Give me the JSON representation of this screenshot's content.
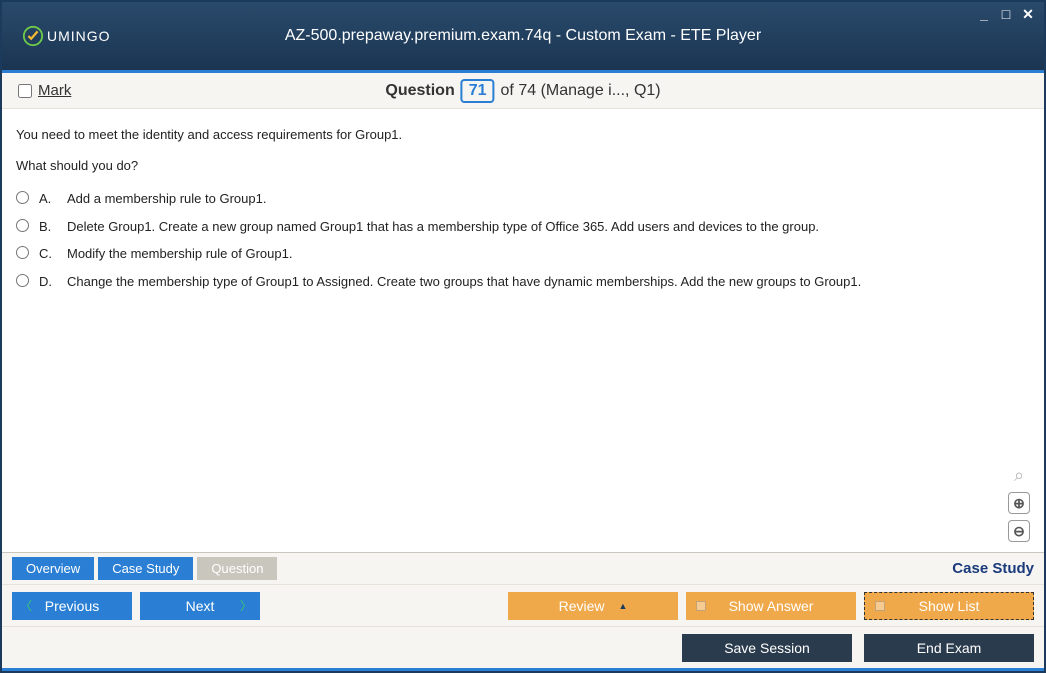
{
  "window": {
    "title": "AZ-500.prepaway.premium.exam.74q - Custom Exam - ETE Player",
    "brand": "UMINGO"
  },
  "header": {
    "mark_label": "Mark",
    "question_word": "Question",
    "current": "71",
    "total": "of 74 (Manage i..., Q1)"
  },
  "question": {
    "line1": "You need to meet the identity and access requirements for Group1.",
    "line2": "What should you do?",
    "options": [
      {
        "letter": "A.",
        "text": "Add a membership rule to Group1."
      },
      {
        "letter": "B.",
        "text": "Delete Group1. Create a new group named Group1 that has a membership type of Office 365. Add users and devices to the group."
      },
      {
        "letter": "C.",
        "text": "Modify the membership rule of Group1."
      },
      {
        "letter": "D.",
        "text": "Change the membership type of Group1 to Assigned. Create two groups that have dynamic memberships. Add the new groups to Group1."
      }
    ]
  },
  "tabs": {
    "overview": "Overview",
    "case_study": "Case Study",
    "question": "Question",
    "right_label": "Case Study"
  },
  "nav": {
    "previous": "Previous",
    "next": "Next",
    "review": "Review",
    "show_answer": "Show Answer",
    "show_list": "Show List",
    "save_session": "Save Session",
    "end_exam": "End Exam"
  }
}
